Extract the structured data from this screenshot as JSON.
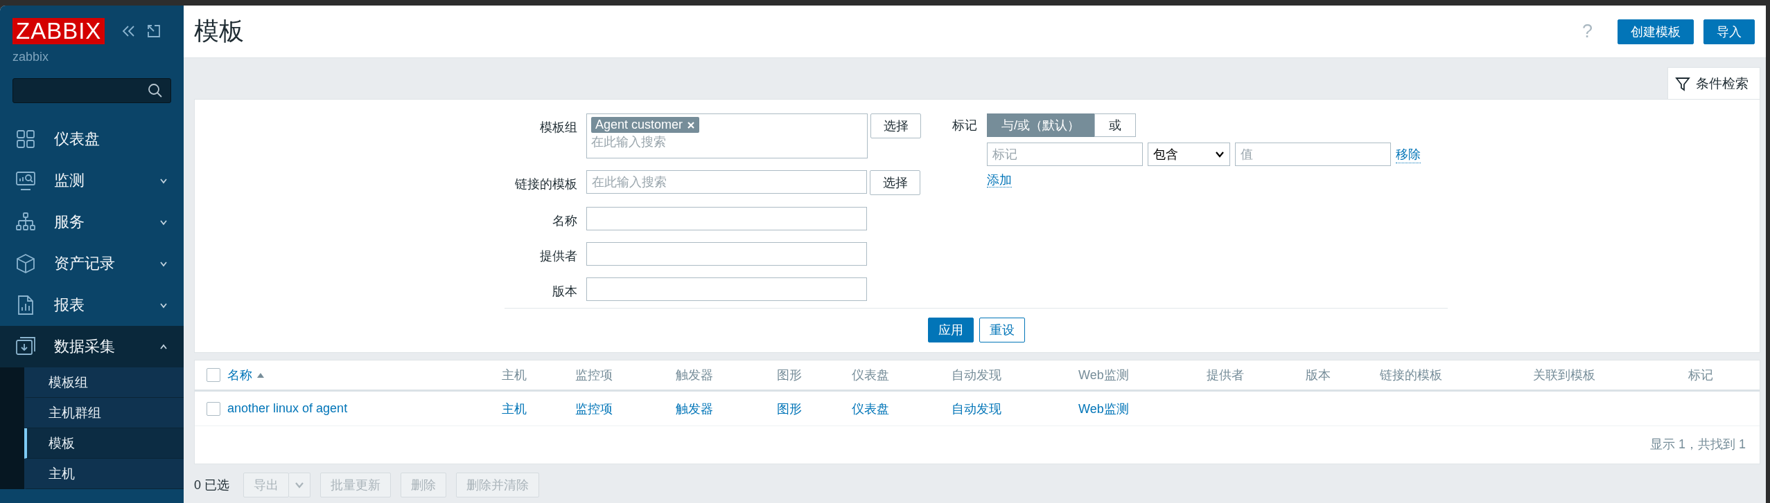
{
  "sidebar": {
    "logo": "ZABBIX",
    "server_name": "zabbix",
    "menu": [
      {
        "kind": "link",
        "label": "仪表盘"
      },
      {
        "kind": "group",
        "label": "监测",
        "expanded": false
      },
      {
        "kind": "group",
        "label": "服务",
        "expanded": false
      },
      {
        "kind": "group",
        "label": "资产记录",
        "expanded": false
      },
      {
        "kind": "group",
        "label": "报表",
        "expanded": false
      },
      {
        "kind": "group",
        "label": "数据采集",
        "expanded": true,
        "children": [
          {
            "label": "模板组",
            "selected": false
          },
          {
            "label": "主机群组",
            "selected": false
          },
          {
            "label": "模板",
            "selected": true
          },
          {
            "label": "主机",
            "selected": false
          }
        ]
      }
    ]
  },
  "header": {
    "title": "模板",
    "help": "?",
    "buttons": [
      "创建模板",
      "导入"
    ]
  },
  "filter": {
    "tab_label": "条件检索",
    "fields": [
      {
        "kind": "multiselect",
        "label": "模板组",
        "tags": [
          "Agent customer"
        ],
        "placeholder": "在此输入搜索",
        "button": "选择"
      },
      {
        "kind": "multiselect",
        "label": "链接的模板",
        "placeholder": "在此输入搜索",
        "button": "选择"
      },
      {
        "kind": "text",
        "label": "名称"
      },
      {
        "kind": "text",
        "label": "提供者"
      },
      {
        "kind": "text",
        "label": "版本"
      }
    ],
    "tag_filter": {
      "label": "标记",
      "modes": [
        {
          "label": "与/或（默认）",
          "selected": true
        },
        {
          "label": "或",
          "selected": false
        }
      ],
      "rows": [
        {
          "tag_placeholder": "标记",
          "operator": "包含",
          "value_placeholder": "值",
          "remove": "移除"
        }
      ],
      "add": "添加"
    },
    "apply": "应用",
    "reset": "重设"
  },
  "table": {
    "select_all": {
      "checked": false
    },
    "columns": [
      {
        "label": "名称",
        "sorted": true
      },
      {
        "label": "主机",
        "sorted": false
      },
      {
        "label": "监控项",
        "sorted": false
      },
      {
        "label": "触发器",
        "sorted": false
      },
      {
        "label": "图形",
        "sorted": false
      },
      {
        "label": "仪表盘",
        "sorted": false
      },
      {
        "label": "自动发现",
        "sorted": false
      },
      {
        "label": "Web监测",
        "sorted": false
      },
      {
        "label": "提供者",
        "sorted": false
      },
      {
        "label": "版本",
        "sorted": false
      },
      {
        "label": "链接的模板",
        "sorted": false
      },
      {
        "label": "关联到模板",
        "sorted": false
      },
      {
        "label": "标记",
        "sorted": false
      }
    ],
    "rows": [
      {
        "checked": false,
        "cells": [
          "another linux of agent",
          "主机",
          "监控项",
          "触发器",
          "图形",
          "仪表盘",
          "自动发现",
          "Web监测"
        ]
      }
    ],
    "footer": "显示 1，共找到 1"
  },
  "actions": {
    "selected_count": "0 已选",
    "buttons": [
      {
        "kind": "split",
        "label": "导出",
        "disabled": true
      },
      {
        "kind": "plain",
        "label": "批量更新",
        "disabled": true
      },
      {
        "kind": "plain",
        "label": "删除",
        "disabled": true
      },
      {
        "kind": "plain",
        "label": "删除并清除",
        "disabled": true
      }
    ]
  }
}
